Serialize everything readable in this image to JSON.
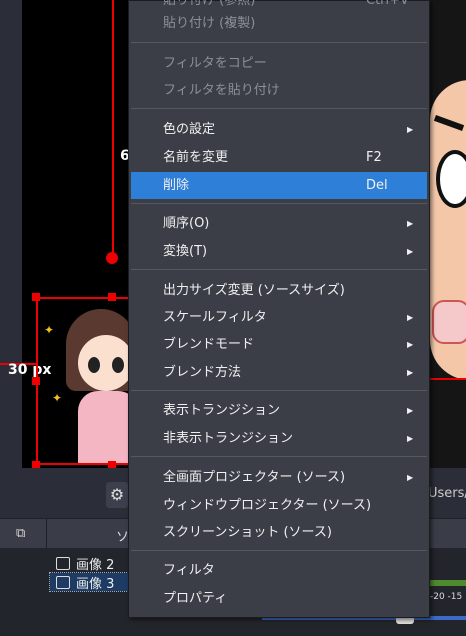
{
  "preview": {
    "label_left": "30 px",
    "label_top_fragment": "6",
    "path_fragment": "Users/"
  },
  "docks": {
    "sources_title_fragment": "ソ",
    "sources": [
      {
        "name": "画像 2",
        "selected": false
      },
      {
        "name": "画像 3",
        "selected": true
      }
    ],
    "meter_labels": "-20  -15"
  },
  "menu": {
    "items": [
      {
        "id": "paste-ref",
        "label": "貼り付け (参照)",
        "shortcut": "Ctrl+V",
        "disabled": true
      },
      {
        "id": "paste-dup",
        "label": "貼り付け (複製)",
        "disabled": true
      },
      {
        "id": "copy-filters",
        "label": "フィルタをコピー",
        "disabled": true
      },
      {
        "id": "paste-filters",
        "label": "フィルタを貼り付け",
        "disabled": true
      },
      {
        "id": "color-settings",
        "label": "色の設定",
        "submenu": true
      },
      {
        "id": "rename",
        "label": "名前を変更",
        "shortcut": "F2"
      },
      {
        "id": "delete",
        "label": "削除",
        "shortcut": "Del",
        "highlighted": true
      },
      {
        "id": "order",
        "label": "順序(O)",
        "submenu": true
      },
      {
        "id": "transform",
        "label": "変換(T)",
        "submenu": true
      },
      {
        "id": "resize-output",
        "label": "出力サイズ変更 (ソースサイズ)"
      },
      {
        "id": "scale-filter",
        "label": "スケールフィルタ",
        "submenu": true
      },
      {
        "id": "blend-mode",
        "label": "ブレンドモード",
        "submenu": true
      },
      {
        "id": "blend-method",
        "label": "ブレンド方法",
        "submenu": true
      },
      {
        "id": "show-transition",
        "label": "表示トランジション",
        "submenu": true
      },
      {
        "id": "hide-transition",
        "label": "非表示トランジション",
        "submenu": true
      },
      {
        "id": "fullscreen-projector",
        "label": "全画面プロジェクター (ソース)",
        "submenu": true
      },
      {
        "id": "window-projector",
        "label": "ウィンドウプロジェクター (ソース)"
      },
      {
        "id": "screenshot",
        "label": "スクリーンショット (ソース)"
      },
      {
        "id": "filters",
        "label": "フィルタ"
      },
      {
        "id": "properties",
        "label": "プロパティ"
      }
    ]
  },
  "colors": {
    "highlight": "#2e7fd8",
    "menu_bg": "#3b3e47",
    "guide": "#e00000"
  }
}
